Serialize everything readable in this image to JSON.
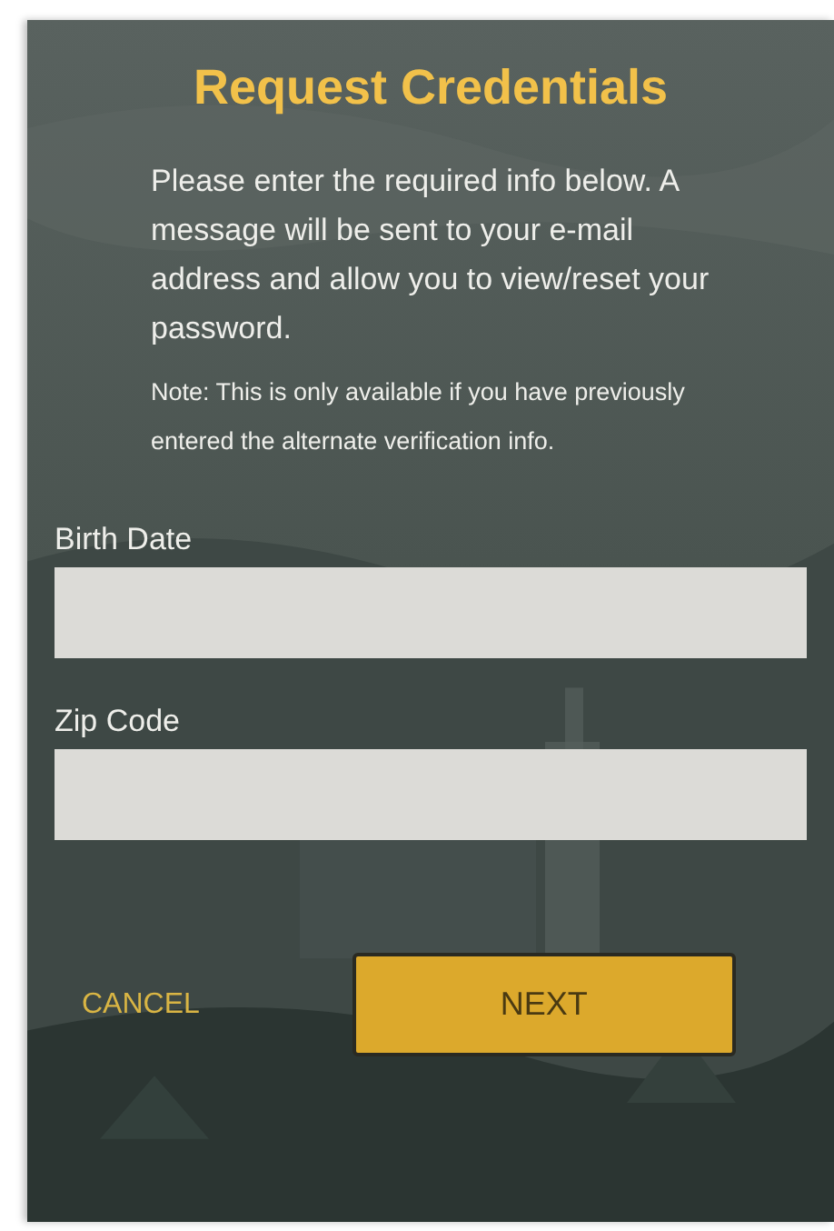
{
  "title": "Request Credentials",
  "intro": "Please enter the required info below. A message will be sent to your e-mail address and allow you to view/reset your password.",
  "note": "Note: This is only available if you have previously entered the alternate verification info.",
  "fields": [
    {
      "label": "Birth Date"
    },
    {
      "label": "Zip Code"
    }
  ],
  "buttons": {
    "cancel": "CANCEL",
    "next": "NEXT"
  }
}
